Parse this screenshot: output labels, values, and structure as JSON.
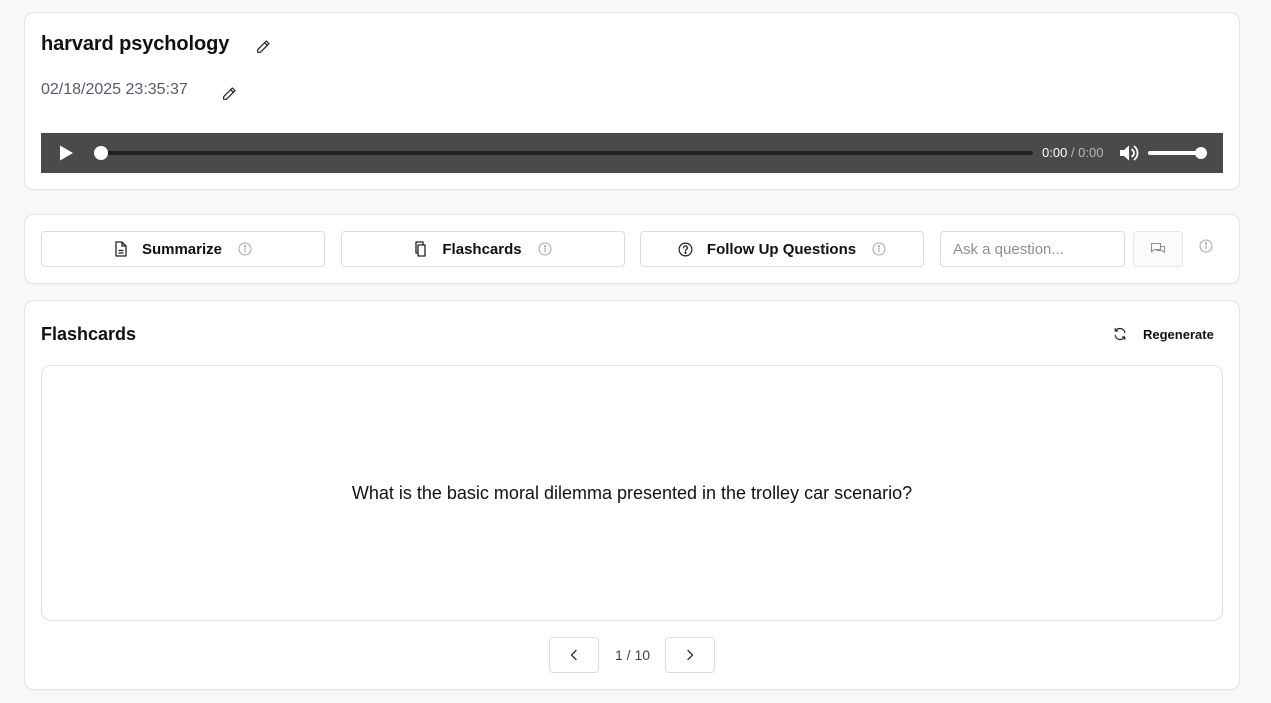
{
  "recording": {
    "title": "harvard psychology",
    "datetime": "02/18/2025 23:35:37"
  },
  "player": {
    "current_time": "0:00",
    "separator": " / ",
    "duration": "0:00",
    "progress": 0,
    "volume": 1.0
  },
  "actions": {
    "summarize_label": "Summarize",
    "flashcards_label": "Flashcards",
    "followup_label": "Follow Up Questions",
    "ask_placeholder": "Ask a question..."
  },
  "flashcards": {
    "heading": "Flashcards",
    "regenerate_label": "Regenerate",
    "question": "What is the basic moral dilemma presented in the trolley car scenario?",
    "counter": "1 / 10"
  },
  "icons": {
    "edit": "pencil-icon",
    "play": "play-icon",
    "volume": "volume-icon",
    "summarize": "document-icon",
    "flashcards": "copy-icon",
    "followup": "help-circle-icon",
    "info": "info-icon",
    "chat": "chat-bubbles-icon",
    "regenerate": "refresh-icon",
    "prev": "chevron-left-icon",
    "next": "chevron-right-icon"
  },
  "colors": {
    "player_bg": "#4a4a4a",
    "page_bg": "#f7f8fa",
    "border": "#d9dce1"
  }
}
